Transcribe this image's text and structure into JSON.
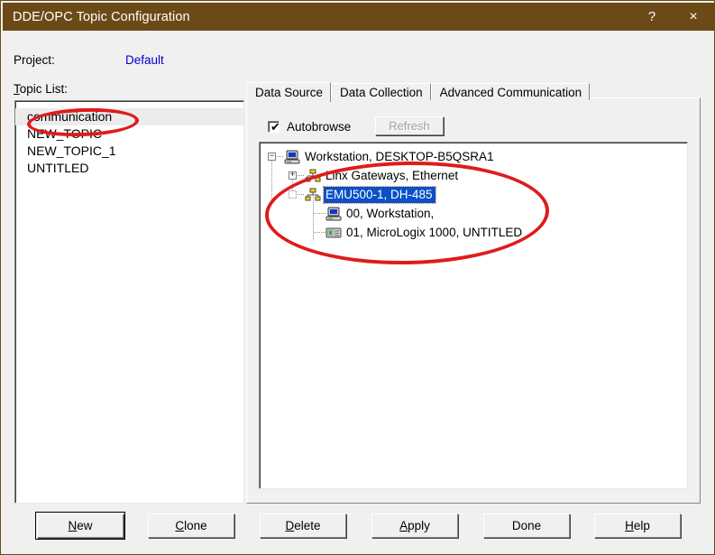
{
  "window": {
    "title": "DDE/OPC Topic Configuration",
    "help_button": "?",
    "close_button": "×",
    "titlebar_color": "#6b4a17"
  },
  "project": {
    "label": "Project:",
    "value": "Default",
    "value_color": "#0000cc"
  },
  "topic_list": {
    "label_prefix": "T",
    "label_rest": "opic List:",
    "items": [
      {
        "name": "communication",
        "selected": true
      },
      {
        "name": "NEW_TOPIC",
        "selected": false
      },
      {
        "name": "NEW_TOPIC_1",
        "selected": false
      },
      {
        "name": "UNTITLED",
        "selected": false
      }
    ]
  },
  "tabs": [
    {
      "label": "Data Source",
      "active": true
    },
    {
      "label": "Data Collection",
      "active": false
    },
    {
      "label": "Advanced Communication",
      "active": false
    }
  ],
  "data_source": {
    "autobrowse": {
      "label": "Autobrowse",
      "checked": true,
      "tick": "✔"
    },
    "refresh_button": {
      "label": "Refresh",
      "enabled": false
    },
    "tree": [
      {
        "label": "Workstation, DESKTOP-B5QSRA1",
        "icon": "workstation-icon",
        "expander": "−",
        "level": 0,
        "selected": false
      },
      {
        "label": "Linx Gateways, Ethernet",
        "icon": "network-icon",
        "expander": "+",
        "level": 1,
        "selected": false
      },
      {
        "label": "EMU500-1, DH-485",
        "icon": "network-icon",
        "expander": "−",
        "level": 1,
        "selected": true
      },
      {
        "label": "00, Workstation,",
        "icon": "workstation-icon",
        "expander": "",
        "level": 2,
        "selected": false
      },
      {
        "label": "01, MicroLogix 1000, UNTITLED",
        "icon": "plc-icon",
        "expander": "",
        "level": 2,
        "selected": false
      }
    ]
  },
  "buttons": [
    {
      "mnemonic": "N",
      "rest": "ew",
      "default": true
    },
    {
      "mnemonic": "C",
      "rest": "lone",
      "default": false
    },
    {
      "mnemonic": "D",
      "rest": "elete",
      "default": false
    },
    {
      "mnemonic": "A",
      "rest": "pply",
      "default": false
    },
    {
      "mnemonic": "",
      "rest": "Done",
      "default": false
    },
    {
      "mnemonic": "H",
      "rest": "elp",
      "default": false
    }
  ],
  "annotations": {
    "color": "#e01b1b",
    "shapes": [
      {
        "name": "topic-highlight",
        "around": "communication"
      },
      {
        "name": "tree-highlight",
        "around": "EMU500-1 branch devices"
      }
    ]
  }
}
